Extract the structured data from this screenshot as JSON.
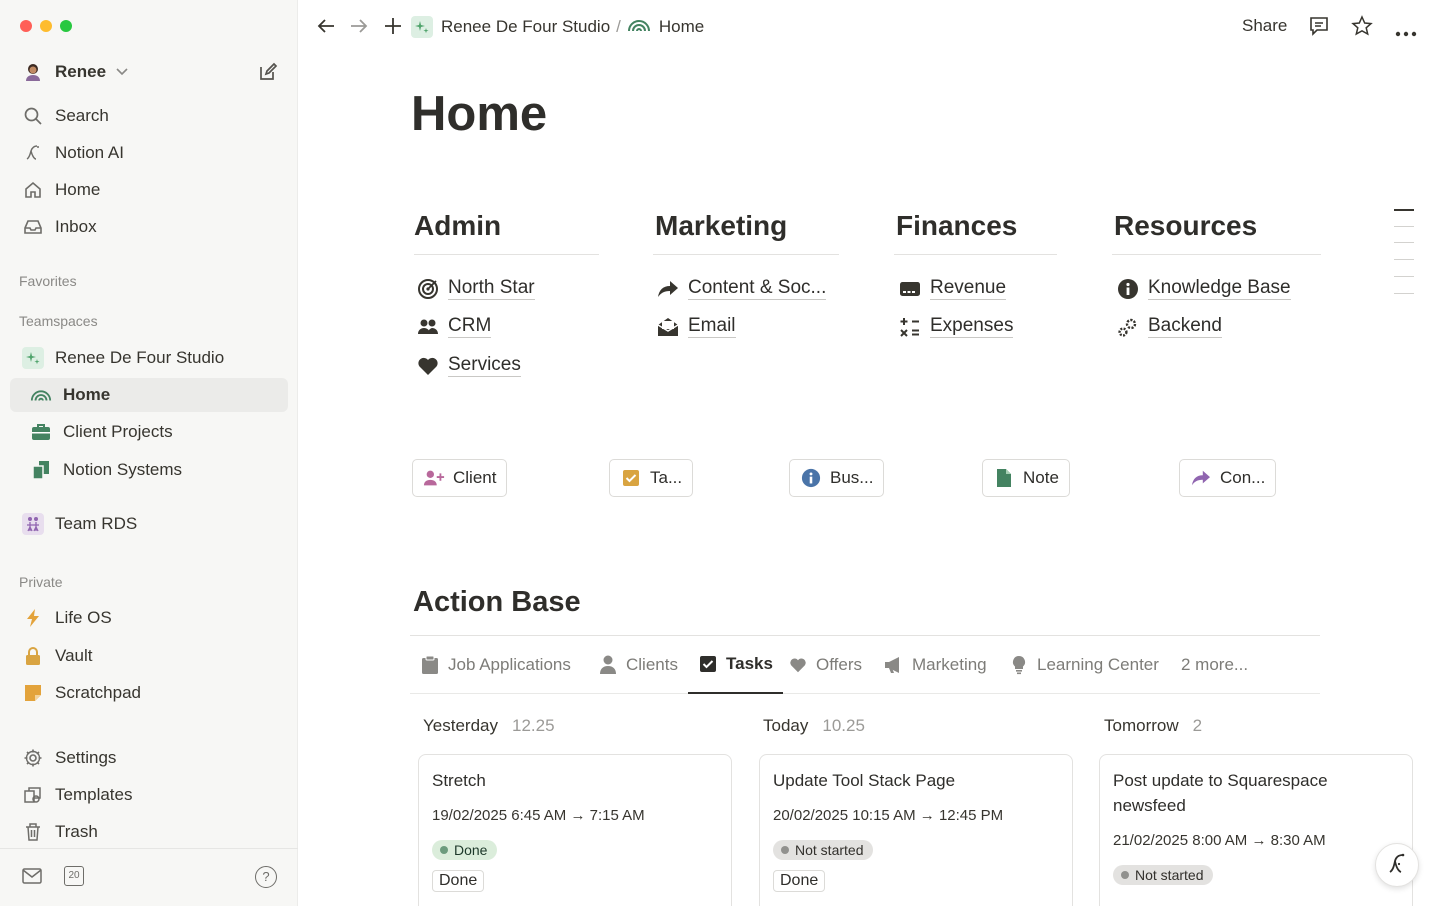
{
  "sidebar": {
    "workspace_user": "Renee",
    "nav": [
      {
        "label": "Search",
        "icon": "search-icon"
      },
      {
        "label": "Notion AI",
        "icon": "notion-ai-icon"
      },
      {
        "label": "Home",
        "icon": "home-icon"
      },
      {
        "label": "Inbox",
        "icon": "inbox-icon"
      }
    ],
    "favorites_label": "Favorites",
    "teamspaces_label": "Teamspaces",
    "teamspace": "Renee De Four Studio",
    "team_pages": [
      {
        "label": "Home",
        "icon": "rainbow-icon"
      },
      {
        "label": "Client Projects",
        "icon": "briefcase-icon"
      },
      {
        "label": "Notion Systems",
        "icon": "documents-icon"
      }
    ],
    "team_rds": "Team RDS",
    "private_label": "Private",
    "private_pages": [
      {
        "label": "Life OS",
        "icon": "lightning-icon"
      },
      {
        "label": "Vault",
        "icon": "lock-icon"
      },
      {
        "label": "Scratchpad",
        "icon": "sticky-note-icon"
      }
    ],
    "footer": [
      {
        "label": "Settings",
        "icon": "gear-icon"
      },
      {
        "label": "Templates",
        "icon": "templates-icon"
      },
      {
        "label": "Trash",
        "icon": "trash-icon"
      }
    ],
    "calendar_day": "20"
  },
  "topbar": {
    "breadcrumb_workspace": "Renee De Four Studio",
    "breadcrumb_sep": "/",
    "breadcrumb_page": "Home",
    "share_label": "Share"
  },
  "page": {
    "title": "Home",
    "columns": [
      {
        "heading": "Admin",
        "links": [
          "North Star",
          "CRM",
          "Services"
        ]
      },
      {
        "heading": "Marketing",
        "links": [
          "Content & Soc...",
          "Email"
        ]
      },
      {
        "heading": "Finances",
        "links": [
          "Revenue",
          "Expenses"
        ]
      },
      {
        "heading": "Resources",
        "links": [
          "Knowledge Base",
          "Backend"
        ]
      }
    ],
    "quick_buttons": [
      "Client",
      "Ta...",
      "Bus...",
      "Note",
      "Con..."
    ]
  },
  "action_base": {
    "title": "Action Base",
    "tabs": [
      "Job Applications",
      "Clients",
      "Tasks",
      "Offers",
      "Marketing",
      "Learning Center",
      "2 more..."
    ],
    "selected_tab": "Tasks",
    "groups": [
      {
        "name": "Yesterday",
        "count": "12.25",
        "card_title": "Stretch",
        "card_date": "19/02/2025 6:45 AM → 7:15 AM",
        "status": "Done",
        "button": "Done"
      },
      {
        "name": "Today",
        "count": "10.25",
        "card_title": "Update Tool Stack Page",
        "card_date": "20/02/2025 10:15 AM → 12:45 PM",
        "status": "Not started",
        "button": "Done"
      },
      {
        "name": "Tomorrow",
        "count": "2",
        "card_title": "Post update to Squarespace newsfeed",
        "card_date": "21/02/2025 8:00 AM → 8:30 AM",
        "status": "Not started",
        "button": ""
      }
    ]
  },
  "colors": {
    "done_bg": "#dbeddb",
    "done_dot": "#6c9b7d",
    "notstarted_bg": "#e3e2e0",
    "notstarted_dot": "#91918e",
    "sparkle": "#4fa36b",
    "rainbow": "#448361"
  }
}
